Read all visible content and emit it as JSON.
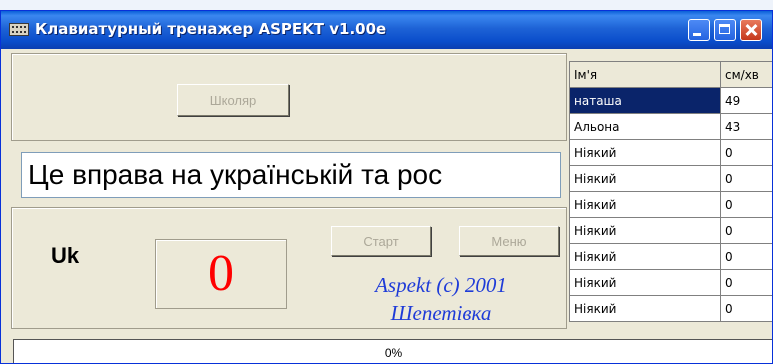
{
  "window": {
    "title": "Клавиатурный тренажер ASPEKT v1.00e",
    "icon": "keyboard-icon"
  },
  "top_panel": {
    "user_button": "Школяр"
  },
  "exercise_text": "Це вправа на українській та рос",
  "bottom_panel": {
    "language": "Uk",
    "counter": "0",
    "start_button": "Старт",
    "menu_button": "Меню",
    "credits_line1": "Aspekt (c) 2001",
    "credits_line2": "Шепетівка"
  },
  "scores": {
    "columns": [
      "Ім'я",
      "см/хв"
    ],
    "rows": [
      {
        "name": "наташа",
        "speed": "49"
      },
      {
        "name": "Альона",
        "speed": "43"
      },
      {
        "name": "Ніякий",
        "speed": "0"
      },
      {
        "name": "Ніякий",
        "speed": "0"
      },
      {
        "name": "Ніякий",
        "speed": "0"
      },
      {
        "name": "Ніякий",
        "speed": "0"
      },
      {
        "name": "Ніякий",
        "speed": "0"
      },
      {
        "name": "Ніякий",
        "speed": "0"
      },
      {
        "name": "Ніякий",
        "speed": "0"
      }
    ],
    "selected_row": 0
  },
  "progress": {
    "label": "0%",
    "value": 0
  },
  "colors": {
    "counter": "#ff0000",
    "credits": "#1e3bd8",
    "selection": "#0a246a"
  }
}
